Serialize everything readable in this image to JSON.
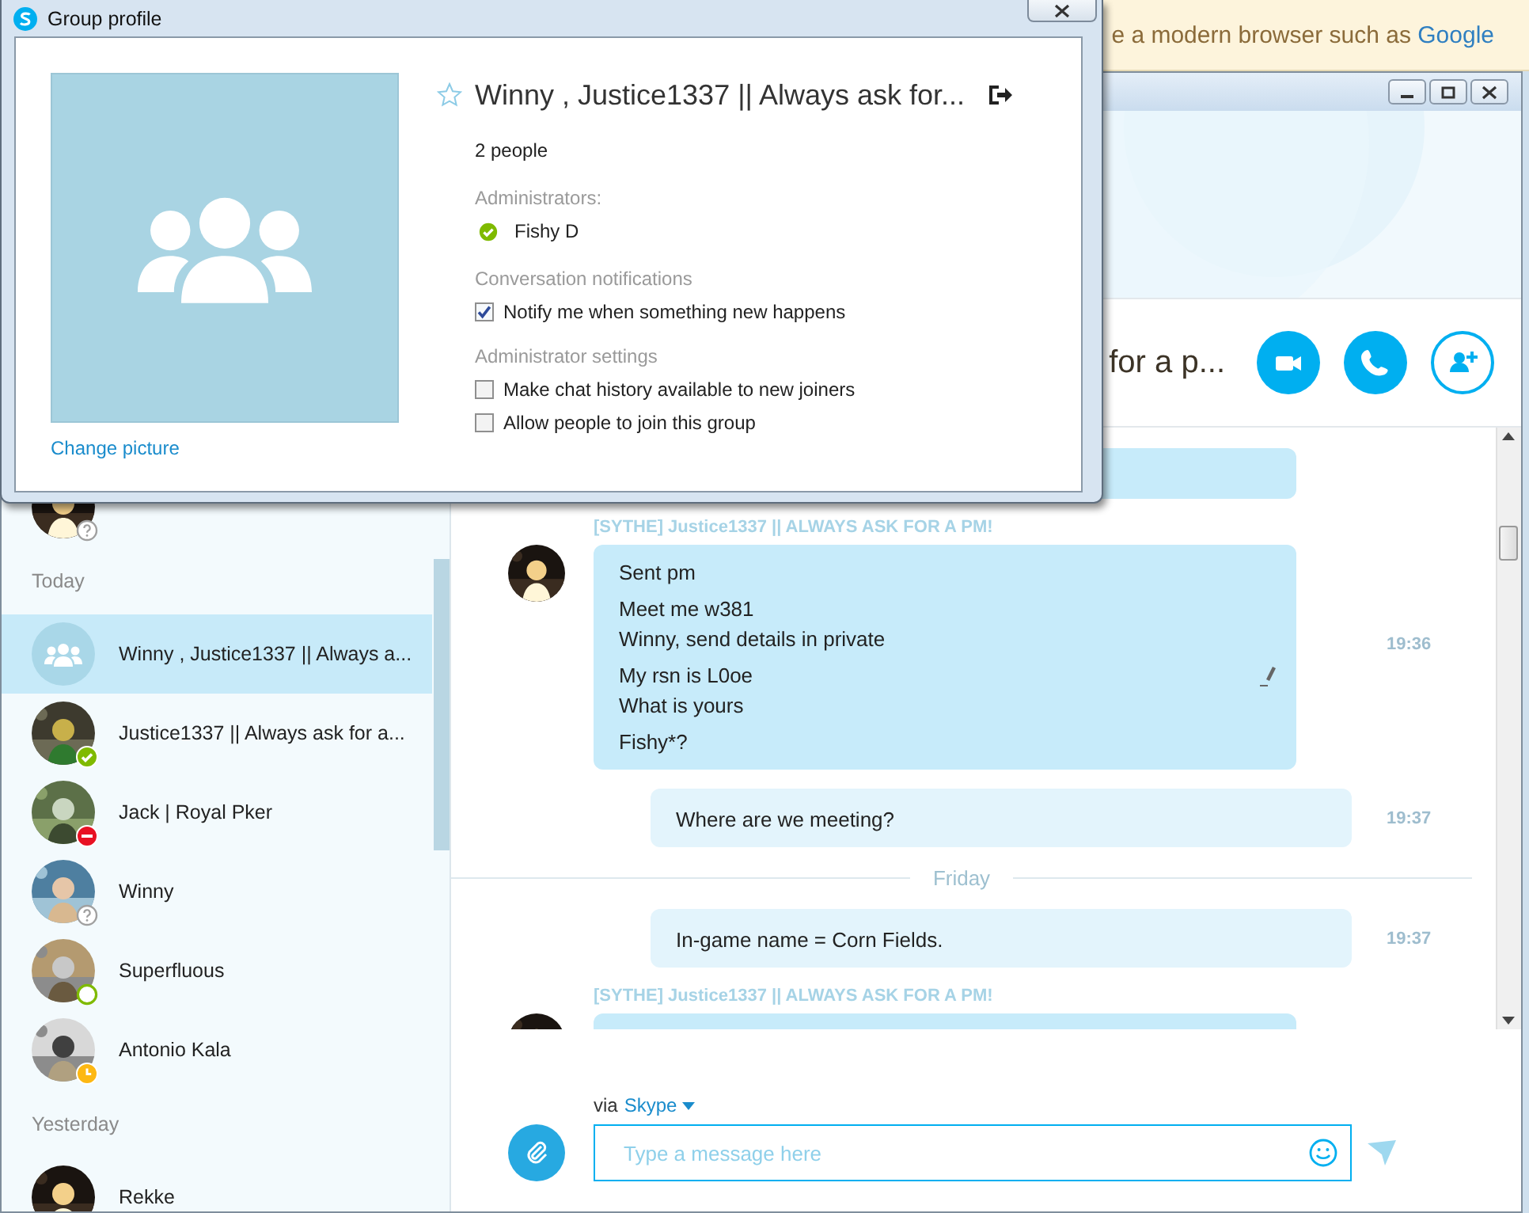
{
  "browser_banner": {
    "text": "e a modern browser such as",
    "link": "Google"
  },
  "dialog": {
    "title": "Group profile",
    "change_picture": "Change picture",
    "group_name": "Winny , Justice1337 || Always ask for...",
    "favorite": false,
    "member_count": "2 people",
    "admins_label": "Administrators:",
    "admins": [
      {
        "name": "Fishy D",
        "status": {
          "kind": "online"
        }
      }
    ],
    "notifications_label": "Conversation notifications",
    "notification_options": [
      {
        "label": "Notify me when something new happens",
        "checked": true
      }
    ],
    "admin_settings_label": "Administrator settings",
    "admin_settings": [
      {
        "label": "Make chat history available to new joiners",
        "checked": false
      },
      {
        "label": "Allow people to join this group",
        "checked": false
      }
    ]
  },
  "sidebar": {
    "sections": [
      {
        "items": [
          {
            "kind": "picture",
            "status": {
              "kind": "unknown"
            },
            "selected": false
          }
        ]
      },
      {
        "label": "Today",
        "items": [
          {
            "name": "Winny , Justice1337 || Always a...",
            "kind": "group",
            "selected": true
          },
          {
            "name": "Justice1337 || Always ask for a...",
            "kind": "picture",
            "status": {
              "kind": "online"
            },
            "selected": false
          },
          {
            "name": "Jack | Royal Pker",
            "kind": "picture",
            "status": {
              "kind": "busy"
            },
            "selected": false
          },
          {
            "name": "Winny",
            "kind": "picture",
            "status": {
              "kind": "unknown"
            },
            "selected": false
          },
          {
            "name": "Superfluous",
            "kind": "picture",
            "status": {
              "kind": "mobile"
            },
            "selected": false
          },
          {
            "name": "Antonio Kala",
            "kind": "picture",
            "status": {
              "kind": "away"
            },
            "selected": false
          }
        ]
      },
      {
        "label": "Yesterday",
        "items": [
          {
            "name": "Rekke",
            "kind": "picture",
            "selected": false
          }
        ]
      }
    ]
  },
  "chat": {
    "title": "for a p...",
    "messages": [
      {
        "kind": "fragment"
      },
      {
        "kind": "incoming",
        "sender": "[SYTHE] Justice1337 || ALWAYS ASK FOR A PM!",
        "paragraphs": [
          [
            "Sent pm"
          ],
          [
            "Meet me w381",
            "Winny, send details in private"
          ],
          [
            "My rsn is L0oe",
            "What is yours"
          ],
          [
            "Fishy*?"
          ]
        ],
        "time": "19:36",
        "edited": true
      },
      {
        "kind": "outgoing",
        "paragraphs": [
          [
            "Where are we meeting?"
          ]
        ],
        "time": "19:37"
      },
      {
        "kind": "divider",
        "label": "Friday"
      },
      {
        "kind": "outgoing",
        "paragraphs": [
          [
            "In-game name = Corn Fields."
          ]
        ],
        "time": "19:37"
      },
      {
        "kind": "incoming",
        "sender": "[SYTHE] Justice1337 || ALWAYS ASK FOR A PM!"
      }
    ]
  },
  "compose": {
    "via": "via",
    "service": "Skype",
    "placeholder": "Type a message here"
  }
}
